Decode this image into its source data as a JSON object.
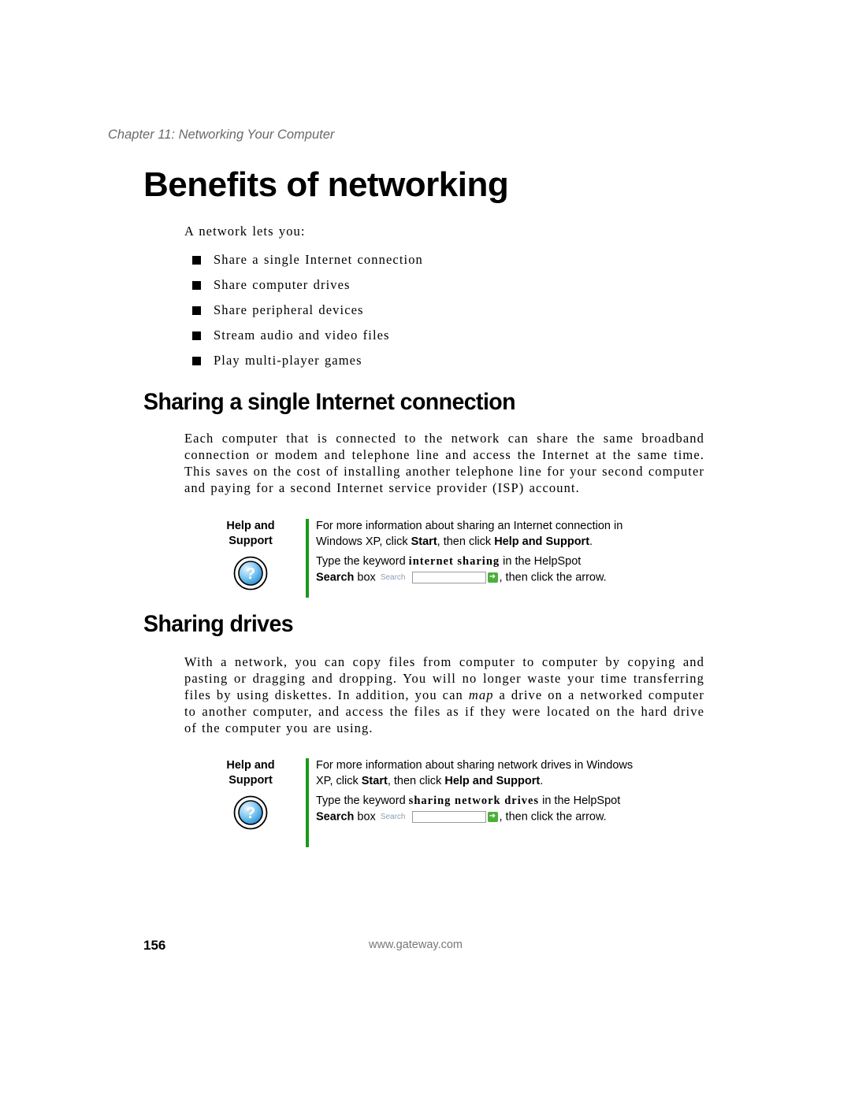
{
  "header": {
    "chapter": "Chapter 11: Networking Your Computer"
  },
  "benefits": {
    "title": "Benefits of networking",
    "intro": "A network lets you:",
    "bullets": [
      "Share a single Internet connection",
      "Share computer drives",
      "Share peripheral devices",
      "Stream audio and video files",
      "Play multi-player games"
    ]
  },
  "internet_section": {
    "title": "Sharing a single Internet connection",
    "paragraph": "Each computer that is connected to the network can share the same broadband connection or modem and telephone line and access the Internet at the same time. This saves on the cost of installing another telephone line for your second computer and paying for a second Internet service provider (ISP) account.",
    "help": {
      "label_line1": "Help and",
      "label_line2": "Support",
      "icon": "help-question-icon",
      "p1_pre": "For more information about sharing an Internet connection in Windows XP, click ",
      "p1_start": "Start",
      "p1_mid": ", then click ",
      "p1_help": "Help and Support",
      "p1_end": ".",
      "p2_pre": "Type the keyword ",
      "p2_keyword": "internet sharing",
      "p2_mid": " in the HelpSpot ",
      "p2_search": "Search",
      "p2_box": " box ",
      "p2_end": ", then click the arrow.",
      "search_widget_label": "Search",
      "search_go_icon": "arrow-right-icon"
    }
  },
  "drives_section": {
    "title": "Sharing drives",
    "paragraph_pre": "With a network, you can copy files from computer to computer by copying and pasting or dragging and dropping. You will no longer waste your time transferring files by using diskettes. In addition, you can ",
    "paragraph_em": "map",
    "paragraph_post": " a drive on a networked computer to another computer, and access the files as if they were located on the hard drive of the computer you are using.",
    "help": {
      "label_line1": "Help and",
      "label_line2": "Support",
      "icon": "help-question-icon",
      "p1_pre": "For more information about sharing network drives in Windows XP, click ",
      "p1_start": "Start",
      "p1_mid": ", then click ",
      "p1_help": "Help and Support",
      "p1_end": ".",
      "p2_pre": "Type the keyword ",
      "p2_keyword": "sharing network drives",
      "p2_mid": " in the HelpSpot ",
      "p2_search": "Search",
      "p2_box": " box ",
      "p2_end": ", then click the arrow.",
      "search_widget_label": "Search",
      "search_go_icon": "arrow-right-icon"
    }
  },
  "footer": {
    "page_number": "156",
    "website": "www.gateway.com"
  },
  "colors": {
    "help_bar": "#1a9a1a",
    "chapter_text": "#6a6a6a",
    "icon_blue": "#3a9fe0"
  }
}
